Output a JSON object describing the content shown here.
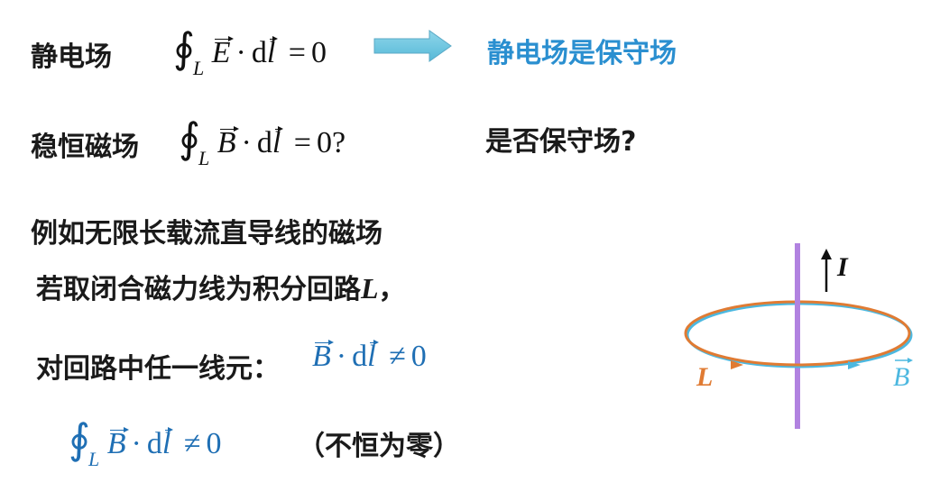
{
  "row1": {
    "label": "静电场",
    "conclusion": "静电场是保守场",
    "formula": {
      "integral_symbol": "∮",
      "sub": "L",
      "field": "E",
      "dot": "·",
      "d": "d",
      "l": "l",
      "eq": "=",
      "rhs": "0"
    }
  },
  "row2": {
    "label": "稳恒磁场",
    "question": "是否保守场?",
    "formula": {
      "integral_symbol": "∮",
      "sub": "L",
      "field": "B",
      "dot": "·",
      "d": "d",
      "l": "l",
      "eq": "=",
      "rhs": "0",
      "q": "?"
    }
  },
  "text": {
    "line1": "例如无限长载流直导线的磁场",
    "line2_prefix": "若取闭合磁力线为积分回路",
    "line2_L": "L",
    "line2_suffix": "，",
    "line3": "对回路中任一线元："
  },
  "element_formula": {
    "field": "B",
    "dot": "·",
    "d": "d",
    "l": "l",
    "neq": "≠",
    "rhs": "0"
  },
  "loop_formula": {
    "integral_symbol": "∮",
    "sub": "L",
    "field": "B",
    "dot": "·",
    "d": "d",
    "l": "l",
    "neq": "≠",
    "rhs": "0"
  },
  "note": "（不恒为零）",
  "diagram": {
    "current_label": "I",
    "loop_label": "L",
    "field_label": "B",
    "colors": {
      "wire": "#b182e0",
      "loop": "#e07b33",
      "field": "#4cb8e0",
      "arrow": "#6ec6dd"
    }
  }
}
